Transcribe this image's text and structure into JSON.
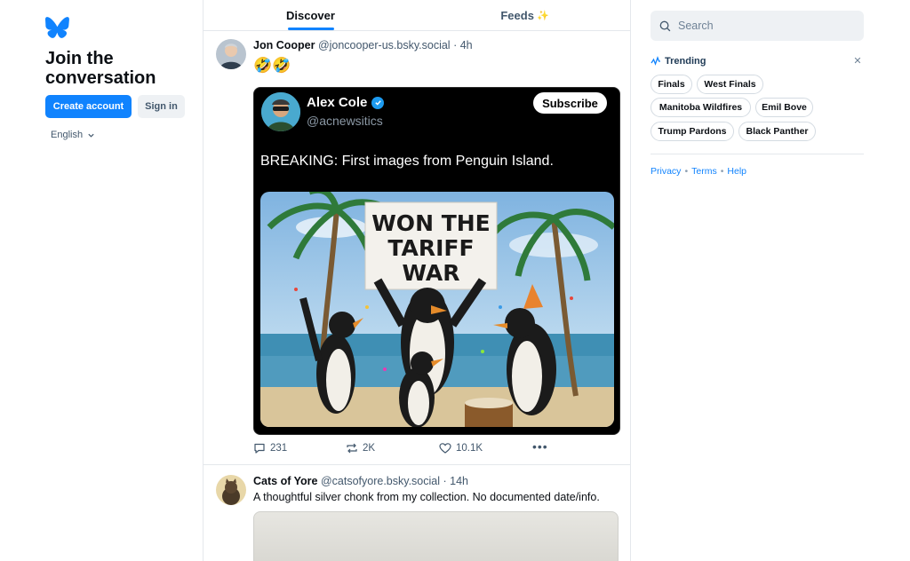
{
  "left": {
    "tagline": "Join the conversation",
    "create_account": "Create account",
    "sign_in": "Sign in",
    "language": "English"
  },
  "tabs": [
    {
      "label": "Discover",
      "active": true
    },
    {
      "label": "Feeds"
    }
  ],
  "posts": [
    {
      "author": "Jon Cooper",
      "handle": "@joncooper-us.bsky.social",
      "time": "4h",
      "text": "🤣🤣",
      "embed": {
        "author": "Alex Cole",
        "handle": "@acnewsitics",
        "subscribe": "Subscribe",
        "text": "BREAKING: First images from Penguin Island.",
        "sign_text": [
          "WON THE",
          "TARIFF",
          "WAR"
        ]
      },
      "replies": "231",
      "reposts": "2K",
      "likes": "10.1K"
    },
    {
      "author": "Cats of Yore",
      "handle": "@catsofyore.bsky.social",
      "time": "14h",
      "text": "A thoughtful silver chonk from my collection. No documented date/info."
    }
  ],
  "search": {
    "placeholder": "Search"
  },
  "trending": {
    "title": "Trending",
    "items": [
      "Finals",
      "West Finals",
      "Manitoba Wildfires",
      "Emil Bove",
      "Trump Pardons",
      "Black Panther"
    ]
  },
  "footer_links": [
    "Privacy",
    "Terms",
    "Help"
  ],
  "colors": {
    "accent": "#1083fe",
    "text": "#0b0f14",
    "muted": "#42576c"
  }
}
